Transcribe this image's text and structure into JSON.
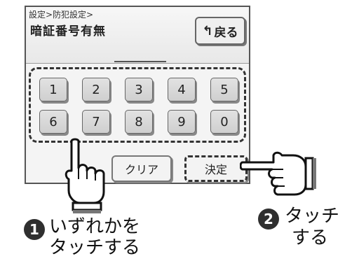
{
  "screen": {
    "breadcrumb": "設定>防犯設定>",
    "title": "暗証番号有無",
    "back_button": {
      "label": "戻る",
      "icon": "return-arrow-icon"
    }
  },
  "keypad": {
    "keys": [
      {
        "label": "1"
      },
      {
        "label": "2"
      },
      {
        "label": "3"
      },
      {
        "label": "4"
      },
      {
        "label": "5"
      },
      {
        "label": "6"
      },
      {
        "label": "7"
      },
      {
        "label": "8"
      },
      {
        "label": "9"
      },
      {
        "label": "0"
      }
    ]
  },
  "actions": {
    "clear_label": "クリア",
    "confirm_label": "決定"
  },
  "instructions": {
    "step1": {
      "number": "1",
      "line1": "いずれかを",
      "line2": "タッチする"
    },
    "step2": {
      "number": "2",
      "line1": "タッチ",
      "line2": "する"
    }
  }
}
